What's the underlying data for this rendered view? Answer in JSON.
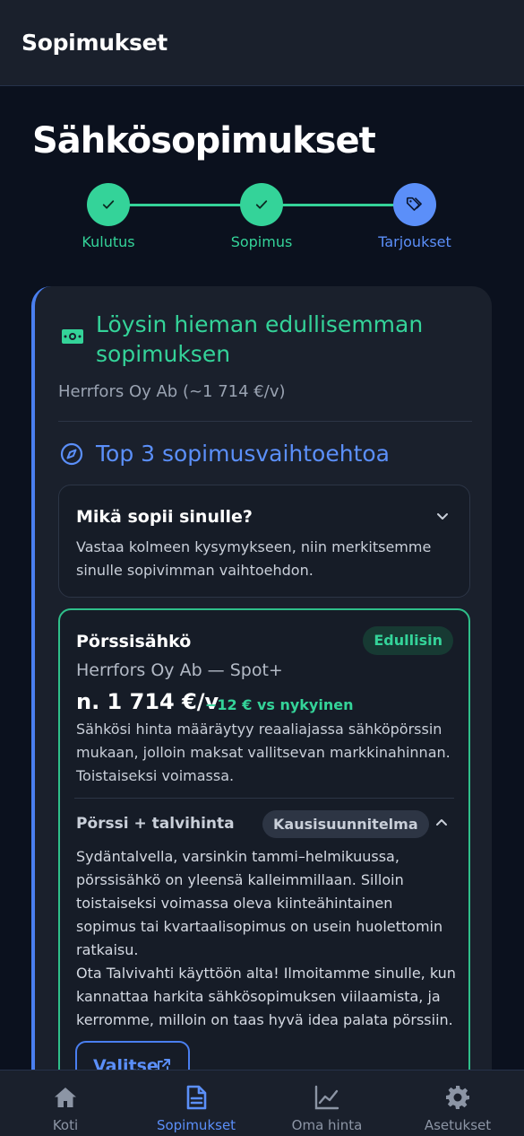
{
  "appbar": {
    "title": "Sopimukset"
  },
  "page": {
    "title": "Sähkösopimukset"
  },
  "stepper": {
    "steps": [
      {
        "label": "Kulutus",
        "state": "done"
      },
      {
        "label": "Sopimus",
        "state": "done"
      },
      {
        "label": "Tarjoukset",
        "state": "current"
      }
    ]
  },
  "result": {
    "title": "Löysin hieman edullisemman sopimuksen",
    "subtitle": "Herrfors Oy Ab (~1 714 €/v)"
  },
  "top3": {
    "title": "Top 3 sopimusvaihtoehtoa"
  },
  "quiz": {
    "title": "Mikä sopii sinulle?",
    "text": "Vastaa kolmeen kysymykseen, niin merkitsemme sinulle sopivimman vaihtoehdon."
  },
  "offer": {
    "name": "Pörssisähkö",
    "badge": "Edullisin",
    "provider": "Herrfors Oy Ab — Spot+",
    "price": "n. 1 714 €/v",
    "diff": "−12 € vs nykyinen",
    "description": "Sähkösi hinta määräytyy reaaliajassa sähköpörssin mukaan, jolloin maksat vallitsevan markkinahinnan. Toistaiseksi voimassa.",
    "plan": {
      "title": "Pörssi + talvihinta",
      "badge": "Kausisuunnitelma",
      "paragraph1": "Sydäntalvella, varsinkin tammi–helmikuussa, pörssisähkö on yleensä kalleimmillaan. Silloin toistaiseksi voimassa oleva kiinteähintainen sopimus tai kvartaalisopimus on usein huolettomin ratkaisu.",
      "paragraph2": "Ota Talvivahti käyttöön alta! Ilmoitamme sinulle, kun kannattaa harkita sähkösopimuksen viilaamista, ja kerromme, milloin on taas hyvä idea palata pörssiin."
    },
    "select_label": "Valitse"
  },
  "nav": {
    "items": [
      {
        "label": "Koti",
        "icon": "home-icon"
      },
      {
        "label": "Sopimukset",
        "icon": "document-icon"
      },
      {
        "label": "Oma hinta",
        "icon": "chart-line-icon"
      },
      {
        "label": "Asetukset",
        "icon": "gear-icon"
      }
    ],
    "active": "Sopimukset"
  },
  "colors": {
    "accent": "#4a7ff0",
    "success": "#34d399",
    "background": "#0b111e",
    "surface": "#1a202c"
  }
}
